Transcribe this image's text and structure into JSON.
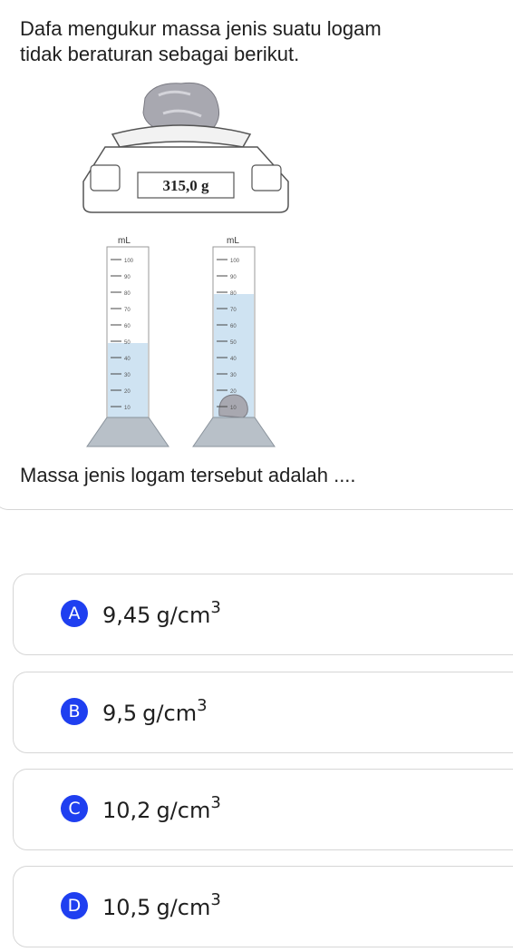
{
  "question": {
    "line1": "Dafa mengukur massa jenis suatu logam",
    "line2": "tidak beraturan sebagai berikut.",
    "prompt": "Massa jenis logam tersebut adalah ...."
  },
  "figure": {
    "scale_reading": "315,0 g",
    "cylinder_unit": "mL",
    "cylinder_ticks": [
      "100",
      "90",
      "80",
      "70",
      "60",
      "50",
      "40",
      "30",
      "20",
      "10"
    ],
    "left_water_level_ml": 50,
    "right_water_level_ml": 80,
    "water_color": "#cfe3f2",
    "stone_color": "#a8a8b0"
  },
  "options": [
    {
      "letter": "A",
      "value": "9,45",
      "unit": "g/cm",
      "exp": "3"
    },
    {
      "letter": "B",
      "value": "9,5",
      "unit": "g/cm",
      "exp": "3"
    },
    {
      "letter": "C",
      "value": "10,2",
      "unit": "g/cm",
      "exp": "3"
    },
    {
      "letter": "D",
      "value": "10,5",
      "unit": "g/cm",
      "exp": "3"
    }
  ],
  "colors": {
    "badge": "#1f3ff0",
    "border": "#d6d6d6"
  }
}
